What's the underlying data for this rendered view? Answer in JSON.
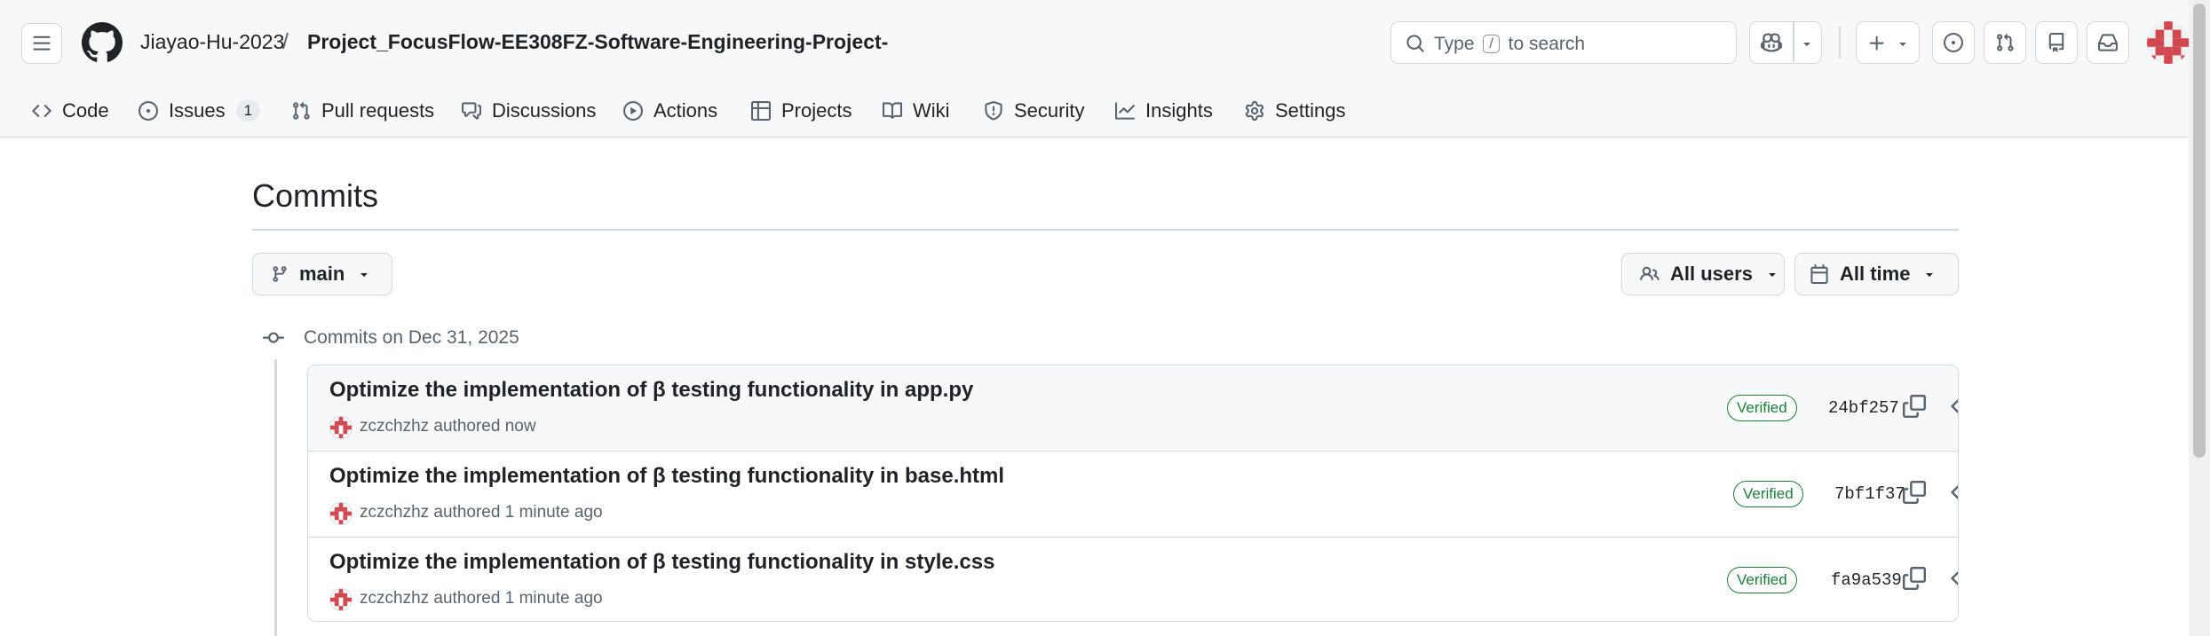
{
  "header": {
    "owner": "Jiayao-Hu-2023",
    "separator": "/",
    "repo": "Project_FocusFlow-EE308FZ-Software-Engineering-Project-",
    "search": {
      "prefix": "Type",
      "key": "/",
      "suffix": "to search"
    }
  },
  "nav": {
    "tabs": [
      {
        "label": "Code",
        "icon": "code-icon"
      },
      {
        "label": "Issues",
        "icon": "issue-opened-icon",
        "counter": "1"
      },
      {
        "label": "Pull requests",
        "icon": "git-pull-request-icon"
      },
      {
        "label": "Discussions",
        "icon": "comment-discussion-icon"
      },
      {
        "label": "Actions",
        "icon": "play-icon"
      },
      {
        "label": "Projects",
        "icon": "table-icon"
      },
      {
        "label": "Wiki",
        "icon": "book-icon"
      },
      {
        "label": "Security",
        "icon": "shield-icon"
      },
      {
        "label": "Insights",
        "icon": "graph-icon"
      },
      {
        "label": "Settings",
        "icon": "gear-icon"
      }
    ]
  },
  "page": {
    "title": "Commits",
    "branch": "main",
    "users_filter": "All users",
    "time_filter": "All time"
  },
  "commit_group": {
    "title": "Commits on Dec 31, 2025",
    "commits": [
      {
        "message": "Optimize the implementation of β testing functionality in app.py",
        "author": "zczchzhz",
        "action": "authored",
        "time": "now",
        "badge": "Verified",
        "sha": "24bf257"
      },
      {
        "message": "Optimize the implementation of β testing functionality in base.html",
        "author": "zczchzhz",
        "action": "authored",
        "time": "1 minute ago",
        "badge": "Verified",
        "sha": "7bf1f37"
      },
      {
        "message": "Optimize the implementation of β testing functionality in style.css",
        "author": "zczchzhz",
        "action": "authored",
        "time": "1 minute ago",
        "badge": "Verified",
        "sha": "fa9a539"
      }
    ]
  },
  "colors": {
    "header_bg": "#f6f8fa",
    "border": "#d1d9e0",
    "text": "#1f2328",
    "muted": "#59636e",
    "verified": "#1a7f37",
    "avatar_red": "#d1484f"
  }
}
